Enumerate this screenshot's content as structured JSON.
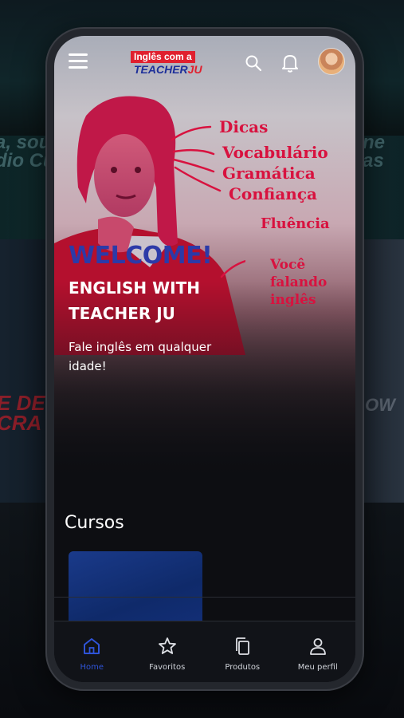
{
  "app": {
    "logo_top": "Inglês com a",
    "logo_bottom_a": "TEACHER",
    "logo_bottom_b": "JU"
  },
  "hero": {
    "welcome": "WELCOME!",
    "title": "ENGLISH WITH TEACHER JU",
    "subtitle": "Fale inglês em qualquer idade!",
    "handwritten": [
      "Dicas",
      "Vocabulário",
      "Gramática",
      "Confiança",
      "Fluência",
      "Você",
      "falando",
      "inglês"
    ]
  },
  "sections": {
    "courses_title": "Cursos"
  },
  "nav": [
    {
      "label": "Home",
      "icon": "home-icon",
      "active": true
    },
    {
      "label": "Favoritos",
      "icon": "star-icon",
      "active": false
    },
    {
      "label": "Produtos",
      "icon": "copy-icon",
      "active": false
    },
    {
      "label": "Meu perfil",
      "icon": "user-icon",
      "active": false
    }
  ],
  "colors": {
    "accent": "#2f54d8",
    "brand_red": "#e0202e",
    "brand_blue": "#1d2f9a",
    "handwriting": "#d8123f"
  }
}
